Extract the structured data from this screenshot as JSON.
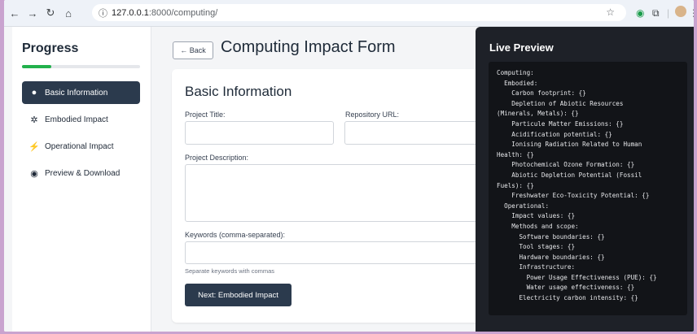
{
  "browser": {
    "url_host": "127.0.0.1",
    "url_rest": ":8000/computing/"
  },
  "sidebar": {
    "title": "Progress",
    "progress": 0.25,
    "items": [
      {
        "label": "Basic Information",
        "icon": "info-circle-icon",
        "active": true
      },
      {
        "label": "Embodied Impact",
        "icon": "gear-icon",
        "active": false
      },
      {
        "label": "Operational Impact",
        "icon": "bolt-icon",
        "active": false
      },
      {
        "label": "Preview & Download",
        "icon": "eye-icon",
        "active": false
      }
    ]
  },
  "main": {
    "back_label": "← Back",
    "page_title": "Computing Impact Form",
    "section_title": "Basic Information",
    "project_title_label": "Project Title:",
    "repository_url_label": "Repository URL:",
    "project_description_label": "Project Description:",
    "keywords_label": "Keywords (comma-separated):",
    "keywords_hint": "Separate keywords with commas",
    "next_button": "Next: Embodied Impact"
  },
  "preview": {
    "title": "Live Preview",
    "content": "Computing:\n  Embodied:\n    Carbon footprint: {}\n    Depletion of Abiotic Resources\n(Minerals, Metals): {}\n    Particule Matter Emissions: {}\n    Acidification potential: {}\n    Ionising Radiation Related to Human\nHealth: {}\n    Photochemical Ozone Formation: {}\n    Abiotic Depletion Potential (Fossil\nFuels): {}\n    Freshwater Eco-Toxicity Potential: {}\n  Operational:\n    Impact values: {}\n    Methods and scope:\n      Software boundaries: {}\n      Tool stages: {}\n      Hardware boundaries: {}\n      Infrastructure:\n        Power Usage Effectiveness (PUE): {}\n        Water usage effectiveness: {}\n      Electricity carbon intensity: {}"
  }
}
